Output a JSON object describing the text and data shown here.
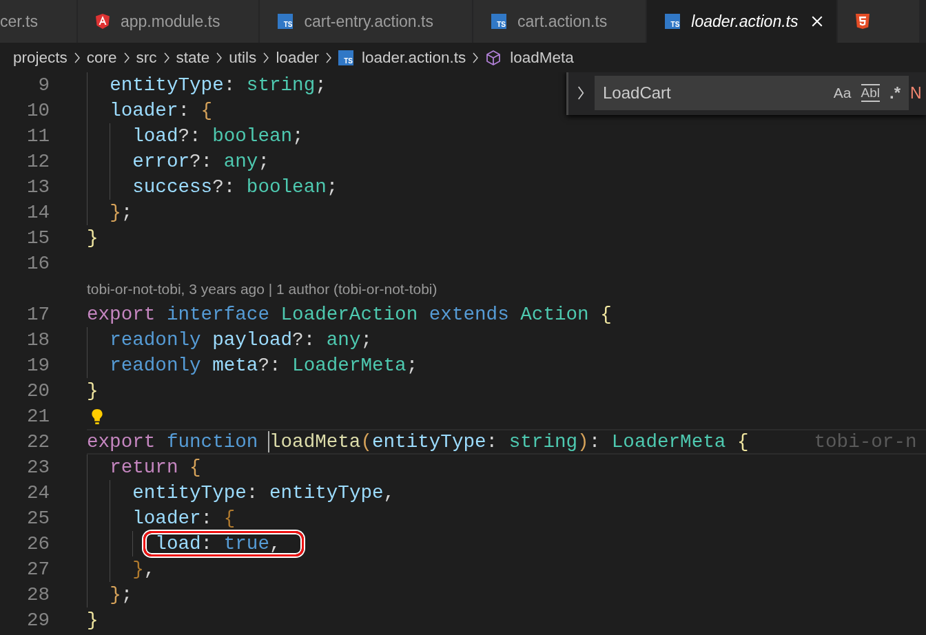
{
  "tabs": [
    {
      "kind": "plain",
      "label": "cer.ts",
      "selected": false,
      "preview": false
    },
    {
      "kind": "angular",
      "label": "app.module.ts",
      "selected": false,
      "preview": false
    },
    {
      "kind": "ts",
      "label": "cart-entry.action.ts",
      "badge": "TS",
      "selected": false,
      "preview": false
    },
    {
      "kind": "ts",
      "label": "cart.action.ts",
      "badge": "TS",
      "selected": false,
      "preview": false
    },
    {
      "kind": "ts",
      "label": "loader.action.ts",
      "badge": "TS",
      "selected": true,
      "preview": true
    },
    {
      "kind": "html",
      "selected": false
    }
  ],
  "breadcrumbs": [
    {
      "kind": "folder",
      "label": "projects"
    },
    {
      "kind": "folder",
      "label": "core"
    },
    {
      "kind": "folder",
      "label": "src"
    },
    {
      "kind": "folder",
      "label": "state"
    },
    {
      "kind": "folder",
      "label": "utils"
    },
    {
      "kind": "folder",
      "label": "loader"
    },
    {
      "kind": "ts",
      "label": "loader.action.ts",
      "badge": "TS"
    },
    {
      "kind": "symbol",
      "label": "loadMeta"
    }
  ],
  "find_widget": {
    "value": "LoadCart",
    "options": [
      {
        "kind": "case",
        "label": "Aa"
      },
      {
        "kind": "word",
        "label": "Abl"
      },
      {
        "kind": "regex",
        "label": ".*"
      }
    ],
    "result": "N"
  },
  "lines": [
    {
      "kind": "code",
      "number": "9",
      "tokens": [
        {
          "kind": "prop",
          "t": "  entityType"
        },
        {
          "kind": "punct",
          "t": ": "
        },
        {
          "kind": "type",
          "t": "string"
        },
        {
          "kind": "punct",
          "t": ";"
        }
      ]
    },
    {
      "kind": "code",
      "number": "10",
      "tokens": [
        {
          "kind": "prop",
          "t": "  loader"
        },
        {
          "kind": "punct",
          "t": ": "
        },
        {
          "kind": "b2",
          "t": "{"
        }
      ]
    },
    {
      "kind": "code",
      "number": "11",
      "tokens": [
        {
          "kind": "prop",
          "t": "    load"
        },
        {
          "kind": "punct",
          "t": "?: "
        },
        {
          "kind": "type",
          "t": "boolean"
        },
        {
          "kind": "punct",
          "t": ";"
        }
      ]
    },
    {
      "kind": "code",
      "number": "12",
      "tokens": [
        {
          "kind": "prop",
          "t": "    error"
        },
        {
          "kind": "punct",
          "t": "?: "
        },
        {
          "kind": "type",
          "t": "any"
        },
        {
          "kind": "punct",
          "t": ";"
        }
      ]
    },
    {
      "kind": "code",
      "number": "13",
      "tokens": [
        {
          "kind": "prop",
          "t": "    success"
        },
        {
          "kind": "punct",
          "t": "?: "
        },
        {
          "kind": "type",
          "t": "boolean"
        },
        {
          "kind": "punct",
          "t": ";"
        }
      ]
    },
    {
      "kind": "code",
      "number": "14",
      "tokens": [
        {
          "kind": "b2",
          "t": "  }"
        },
        {
          "kind": "punct",
          "t": ";"
        }
      ]
    },
    {
      "kind": "code",
      "number": "15",
      "tokens": [
        {
          "kind": "b1",
          "t": "}"
        }
      ]
    },
    {
      "kind": "code",
      "number": "16"
    },
    {
      "kind": "codelens",
      "text": "tobi-or-not-tobi, 3 years ago | 1 author (tobi-or-not-tobi)"
    },
    {
      "kind": "code",
      "number": "17",
      "tokens": [
        {
          "kind": "kw",
          "t": "export "
        },
        {
          "kind": "storage",
          "t": "interface "
        },
        {
          "kind": "type",
          "t": "LoaderAction "
        },
        {
          "kind": "storage",
          "t": "extends "
        },
        {
          "kind": "type",
          "t": "Action "
        },
        {
          "kind": "b1",
          "t": "{"
        }
      ]
    },
    {
      "kind": "code",
      "number": "18",
      "tokens": [
        {
          "kind": "storage",
          "t": "  readonly "
        },
        {
          "kind": "prop",
          "t": "payload"
        },
        {
          "kind": "punct",
          "t": "?: "
        },
        {
          "kind": "type",
          "t": "any"
        },
        {
          "kind": "punct",
          "t": ";"
        }
      ]
    },
    {
      "kind": "code",
      "number": "19",
      "tokens": [
        {
          "kind": "storage",
          "t": "  readonly "
        },
        {
          "kind": "prop",
          "t": "meta"
        },
        {
          "kind": "punct",
          "t": "?: "
        },
        {
          "kind": "type",
          "t": "LoaderMeta"
        },
        {
          "kind": "punct",
          "t": ";"
        }
      ]
    },
    {
      "kind": "code",
      "number": "20",
      "tokens": [
        {
          "kind": "b1",
          "t": "}"
        }
      ]
    },
    {
      "kind": "code",
      "number": "21",
      "lightbulb": true
    },
    {
      "kind": "code",
      "number": "22",
      "current": true,
      "blame": "tobi-or-n",
      "tokens": [
        {
          "kind": "kw",
          "t": "export "
        },
        {
          "kind": "storage",
          "t": "function "
        },
        {
          "kind": "fn",
          "t": "loadMeta",
          "cursor": true
        },
        {
          "kind": "b2",
          "t": "("
        },
        {
          "kind": "prop",
          "t": "entityType"
        },
        {
          "kind": "punct",
          "t": ": "
        },
        {
          "kind": "type",
          "t": "string"
        },
        {
          "kind": "b2",
          "t": ")"
        },
        {
          "kind": "punct",
          "t": ": "
        },
        {
          "kind": "type",
          "t": "LoaderMeta "
        },
        {
          "kind": "b1",
          "t": "{"
        }
      ]
    },
    {
      "kind": "code",
      "number": "23",
      "tokens": [
        {
          "kind": "kw",
          "t": "  return "
        },
        {
          "kind": "b2",
          "t": "{"
        }
      ]
    },
    {
      "kind": "code",
      "number": "24",
      "tokens": [
        {
          "kind": "prop",
          "t": "    entityType"
        },
        {
          "kind": "punct",
          "t": ": "
        },
        {
          "kind": "prop",
          "t": "entityType"
        },
        {
          "kind": "punct",
          "t": ","
        }
      ]
    },
    {
      "kind": "code",
      "number": "25",
      "tokens": [
        {
          "kind": "prop",
          "t": "    loader"
        },
        {
          "kind": "punct",
          "t": ": "
        },
        {
          "kind": "b3",
          "t": "{"
        }
      ]
    },
    {
      "kind": "code",
      "number": "26",
      "highlighted": true,
      "tokens": [
        {
          "kind": "prop",
          "t": "      load"
        },
        {
          "kind": "punct",
          "t": ": "
        },
        {
          "kind": "const",
          "t": "true"
        },
        {
          "kind": "punct",
          "t": ","
        }
      ]
    },
    {
      "kind": "code",
      "number": "27",
      "tokens": [
        {
          "kind": "b3",
          "t": "    }"
        },
        {
          "kind": "punct",
          "t": ","
        }
      ]
    },
    {
      "kind": "code",
      "number": "28",
      "tokens": [
        {
          "kind": "b2",
          "t": "  }"
        },
        {
          "kind": "punct",
          "t": ";"
        }
      ]
    },
    {
      "kind": "code",
      "number": "29",
      "tokens": [
        {
          "kind": "b1",
          "t": "}"
        }
      ]
    }
  ]
}
